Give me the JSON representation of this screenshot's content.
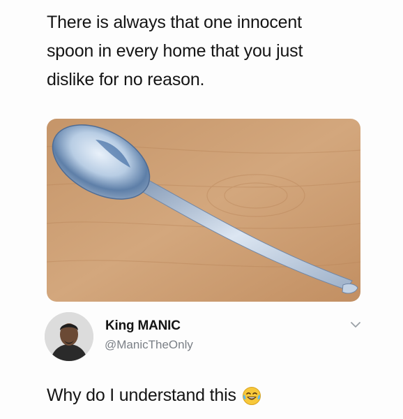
{
  "post": {
    "caption_lines": [
      "There is always that one innocent",
      "spoon in every home that you just",
      "dislike for no reason."
    ]
  },
  "reply": {
    "display_name": "King MANIC",
    "handle": "@ManicTheOnly",
    "text": "Why do I understand this",
    "emoji": "laughing-crying-emoji",
    "menu_icon": "chevron-down-icon"
  },
  "colors": {
    "text": "#141414",
    "handle": "#7a7f86",
    "wood": "#c89a6e",
    "spoon": "#a9bdd6"
  }
}
